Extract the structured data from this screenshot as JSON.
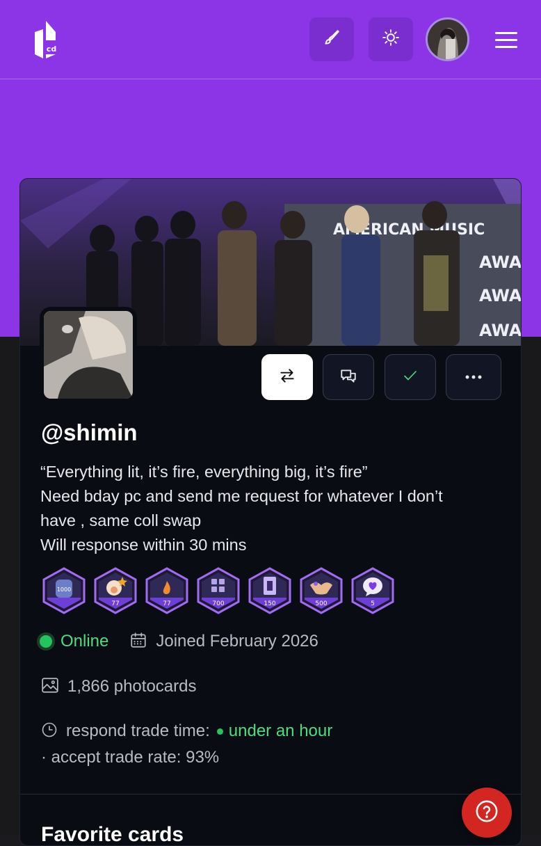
{
  "header": {
    "logo_text": "cd",
    "brush_icon": "paintbrush-icon",
    "theme_icon": "sun-icon",
    "avatar": "user-avatar",
    "menu_icon": "hamburger-menu-icon"
  },
  "profile": {
    "banner_text_lines": [
      "AMERICAN MUSIC",
      "AWARDS",
      "AWARDS",
      "AWARDS"
    ],
    "username": "@shimin",
    "bio": [
      "“Everything lit, it’s fire, everything big, it’s fire”",
      "Need bday pc and send me request for whatever I don’t",
      "have , same coll swap",
      "Will response within 30 mins"
    ],
    "actions": {
      "trade_icon": "swap-arrows-icon",
      "message_icon": "chat-bubbles-icon",
      "verify_icon": "checkmark-icon",
      "more_icon": "more-dots-icon"
    },
    "badges": [
      {
        "icon": "trophy-1000-icon",
        "label": "1000"
      },
      {
        "icon": "egg-character-icon",
        "label": "77"
      },
      {
        "icon": "flame-icon",
        "label": "77"
      },
      {
        "icon": "cards-grid-icon",
        "label": "700"
      },
      {
        "icon": "photocard-icon",
        "label": "150"
      },
      {
        "icon": "handshake-icon",
        "label": "500"
      },
      {
        "icon": "heart-speech-icon",
        "label": "5"
      }
    ],
    "status": "Online",
    "joined": "Joined February 2026",
    "photocards": "1,866 photocards",
    "respond_label": "respond trade time:",
    "respond_value": "under an hour",
    "accept_rate": "· accept trade rate: 93%",
    "next_section_heading": "Favorite cards"
  },
  "colors": {
    "header_bg": "#8b35e6",
    "online_green": "#4ade80",
    "card_bg": "#0a0c14",
    "help_red": "#d32620"
  },
  "help_icon": "question-mark-icon"
}
